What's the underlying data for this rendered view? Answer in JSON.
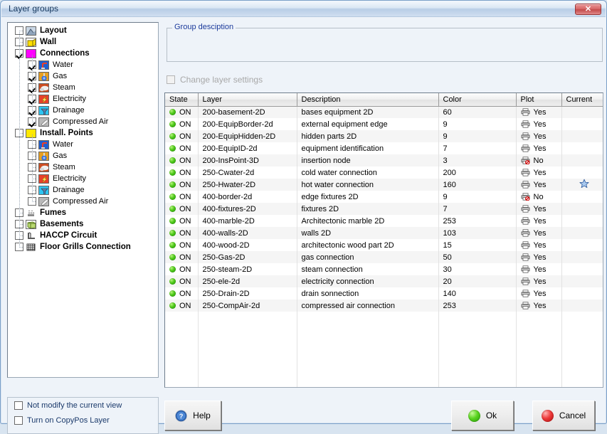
{
  "window": {
    "title": "Layer groups",
    "close_label": "✕"
  },
  "tree": {
    "nodes": [
      {
        "level": 0,
        "label": "Layout",
        "bold": true,
        "checked": false,
        "expander": "",
        "icon": "layout-icon",
        "icon_color": "#b9c6d4"
      },
      {
        "level": 0,
        "label": "Wall",
        "bold": true,
        "checked": false,
        "expander": "",
        "icon": "wall-icon",
        "icon_color": "#ffe000"
      },
      {
        "level": 0,
        "label": "Connections",
        "bold": true,
        "checked": true,
        "expander": "−",
        "icon": "connections-icon",
        "icon_color": "#ff00ff"
      },
      {
        "level": 1,
        "label": "Water",
        "bold": false,
        "checked": true,
        "expander": "",
        "icon": "water-icon",
        "icon_color": "#1f5fd0"
      },
      {
        "level": 1,
        "label": "Gas",
        "bold": false,
        "checked": true,
        "expander": "",
        "icon": "gas-icon",
        "icon_color": "#e8a020"
      },
      {
        "level": 1,
        "label": "Steam",
        "bold": false,
        "checked": true,
        "expander": "",
        "icon": "steam-icon",
        "icon_color": "#cc4d22"
      },
      {
        "level": 1,
        "label": "Electricity",
        "bold": false,
        "checked": true,
        "expander": "",
        "icon": "electricity-icon",
        "icon_color": "#e8402a"
      },
      {
        "level": 1,
        "label": "Drainage",
        "bold": false,
        "checked": true,
        "expander": "",
        "icon": "drainage-icon",
        "icon_color": "#2ec4f0"
      },
      {
        "level": 1,
        "label": "Compressed Air",
        "bold": false,
        "checked": true,
        "expander": "",
        "icon": "compressed-air-icon",
        "icon_color": "#b9b9b9"
      },
      {
        "level": 0,
        "label": "Install. Points",
        "bold": true,
        "checked": false,
        "expander": "−",
        "icon": "install-points-icon",
        "icon_color": "#ffe800"
      },
      {
        "level": 1,
        "label": "Water",
        "bold": false,
        "checked": false,
        "expander": "+",
        "icon": "water-icon",
        "icon_color": "#1f5fd0"
      },
      {
        "level": 1,
        "label": "Gas",
        "bold": false,
        "checked": false,
        "expander": "+",
        "icon": "gas-icon",
        "icon_color": "#e8a020"
      },
      {
        "level": 1,
        "label": "Steam",
        "bold": false,
        "checked": false,
        "expander": "+",
        "icon": "steam-icon",
        "icon_color": "#cc4d22"
      },
      {
        "level": 1,
        "label": "Electricity",
        "bold": false,
        "checked": false,
        "expander": "+",
        "icon": "electricity-icon",
        "icon_color": "#e8402a"
      },
      {
        "level": 1,
        "label": "Drainage",
        "bold": false,
        "checked": false,
        "expander": "+",
        "icon": "drainage-icon",
        "icon_color": "#2ec4f0"
      },
      {
        "level": 1,
        "label": "Compressed Air",
        "bold": false,
        "checked": false,
        "expander": "+",
        "icon": "compressed-air-icon",
        "icon_color": "#b9b9b9"
      },
      {
        "level": 0,
        "label": "Fumes",
        "bold": true,
        "checked": false,
        "expander": "",
        "icon": "fumes-icon",
        "icon_color": "#ffffff"
      },
      {
        "level": 0,
        "label": "Basements",
        "bold": true,
        "checked": false,
        "expander": "",
        "icon": "basements-icon",
        "icon_color": "#b8d870"
      },
      {
        "level": 0,
        "label": "HACCP Circuit",
        "bold": true,
        "checked": false,
        "expander": "",
        "icon": "haccp-circuit-icon",
        "icon_color": "#ffffff"
      },
      {
        "level": 0,
        "label": "Floor Grills Connection",
        "bold": true,
        "checked": false,
        "expander": "",
        "icon": "floor-grills-icon",
        "icon_color": "#ffffff"
      }
    ]
  },
  "options": {
    "not_modify_view": {
      "label": "Not modify the current view",
      "checked": false
    },
    "turn_on_copypos": {
      "label": "Turn on CopyPos Layer",
      "checked": false
    }
  },
  "group_description": {
    "legend": "Group desciption",
    "text": ""
  },
  "change_layer_settings": {
    "label": "Change layer settings",
    "checked": false,
    "disabled": true
  },
  "table": {
    "columns": [
      "State",
      "Layer",
      "Description",
      "Color",
      "Plot",
      "Current"
    ],
    "rows": [
      {
        "state": "ON",
        "layer": "200-basement-2D",
        "description": "bases equipment 2D",
        "color": "60",
        "plot": "Yes",
        "current": false
      },
      {
        "state": "ON",
        "layer": "200-EquipBorder-2d",
        "description": "external equipment edge",
        "color": "9",
        "plot": "Yes",
        "current": false
      },
      {
        "state": "ON",
        "layer": "200-EquipHidden-2D",
        "description": "hidden parts 2D",
        "color": "9",
        "plot": "Yes",
        "current": false
      },
      {
        "state": "ON",
        "layer": "200-EquipID-2d",
        "description": "equipment identification",
        "color": "7",
        "plot": "Yes",
        "current": false
      },
      {
        "state": "ON",
        "layer": "200-InsPoint-3D",
        "description": "insertion node",
        "color": "3",
        "plot": "No",
        "current": false
      },
      {
        "state": "ON",
        "layer": "250-Cwater-2d",
        "description": "cold water connection",
        "color": "200",
        "plot": "Yes",
        "current": false
      },
      {
        "state": "ON",
        "layer": "250-Hwater-2D",
        "description": "hot water connection",
        "color": "160",
        "plot": "Yes",
        "current": true
      },
      {
        "state": "ON",
        "layer": "400-border-2d",
        "description": "edge fixtures 2D",
        "color": "9",
        "plot": "No",
        "current": false
      },
      {
        "state": "ON",
        "layer": "400-fixtures-2D",
        "description": "fixtures 2D",
        "color": "7",
        "plot": "Yes",
        "current": false
      },
      {
        "state": "ON",
        "layer": "400-marble-2D",
        "description": "Architectonic marble 2D",
        "color": "253",
        "plot": "Yes",
        "current": false
      },
      {
        "state": "ON",
        "layer": "400-walls-2D",
        "description": "walls 2D",
        "color": "103",
        "plot": "Yes",
        "current": false
      },
      {
        "state": "ON",
        "layer": "400-wood-2D",
        "description": "architectonic wood part 2D",
        "color": "15",
        "plot": "Yes",
        "current": false
      },
      {
        "state": "ON",
        "layer": "250-Gas-2D",
        "description": "gas connection",
        "color": "50",
        "plot": "Yes",
        "current": false
      },
      {
        "state": "ON",
        "layer": "250-steam-2D",
        "description": "steam connection",
        "color": "30",
        "plot": "Yes",
        "current": false
      },
      {
        "state": "ON",
        "layer": "250-ele-2d",
        "description": "electricity connection",
        "color": "20",
        "plot": "Yes",
        "current": false
      },
      {
        "state": "ON",
        "layer": "250-Drain-2D",
        "description": "drain sonnection",
        "color": "140",
        "plot": "Yes",
        "current": false
      },
      {
        "state": "ON",
        "layer": "250-CompAir-2d",
        "description": "compressed air connection",
        "color": "253",
        "plot": "Yes",
        "current": false
      }
    ],
    "empty_row_count": 7
  },
  "buttons": {
    "help": {
      "label": "Help",
      "icon": "help-question-icon"
    },
    "ok": {
      "label": "Ok",
      "icon": "green-led-icon"
    },
    "cancel": {
      "label": "Cancel",
      "icon": "red-led-icon"
    }
  },
  "colors": {
    "title_text": "#15375e",
    "legend_text": "#1b3a9b",
    "option_text": "#1b3a6b",
    "disabled_text": "#a8a8a8",
    "led_on": "#4fc91a",
    "star": "#7da7dc"
  }
}
